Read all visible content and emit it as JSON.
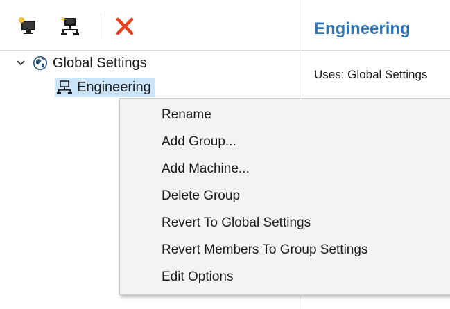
{
  "toolbar": {
    "buttons": [
      {
        "name": "add-machine-button",
        "icon": "new-machine-icon"
      },
      {
        "name": "add-group-button",
        "icon": "new-group-icon"
      },
      {
        "name": "delete-button",
        "icon": "delete-x-icon",
        "color": "#e8401c"
      }
    ]
  },
  "tree": {
    "root": {
      "label": "Global Settings",
      "icon": "globe-icon",
      "expanded": true
    },
    "child": {
      "label": "Engineering",
      "icon": "network-group-icon",
      "selected": true
    }
  },
  "detail": {
    "title": "Engineering",
    "uses": "Uses: Global Settings"
  },
  "context_menu": {
    "items": [
      "Rename",
      "Add Group...",
      "Add Machine...",
      "Delete Group",
      "Revert To Global Settings",
      "Revert Members To Group Settings",
      "Edit Options"
    ]
  },
  "colors": {
    "accent": "#2e75b6",
    "selection": "#cce4f7",
    "delete": "#e8401c",
    "menu_bg": "#f3f3f3"
  }
}
